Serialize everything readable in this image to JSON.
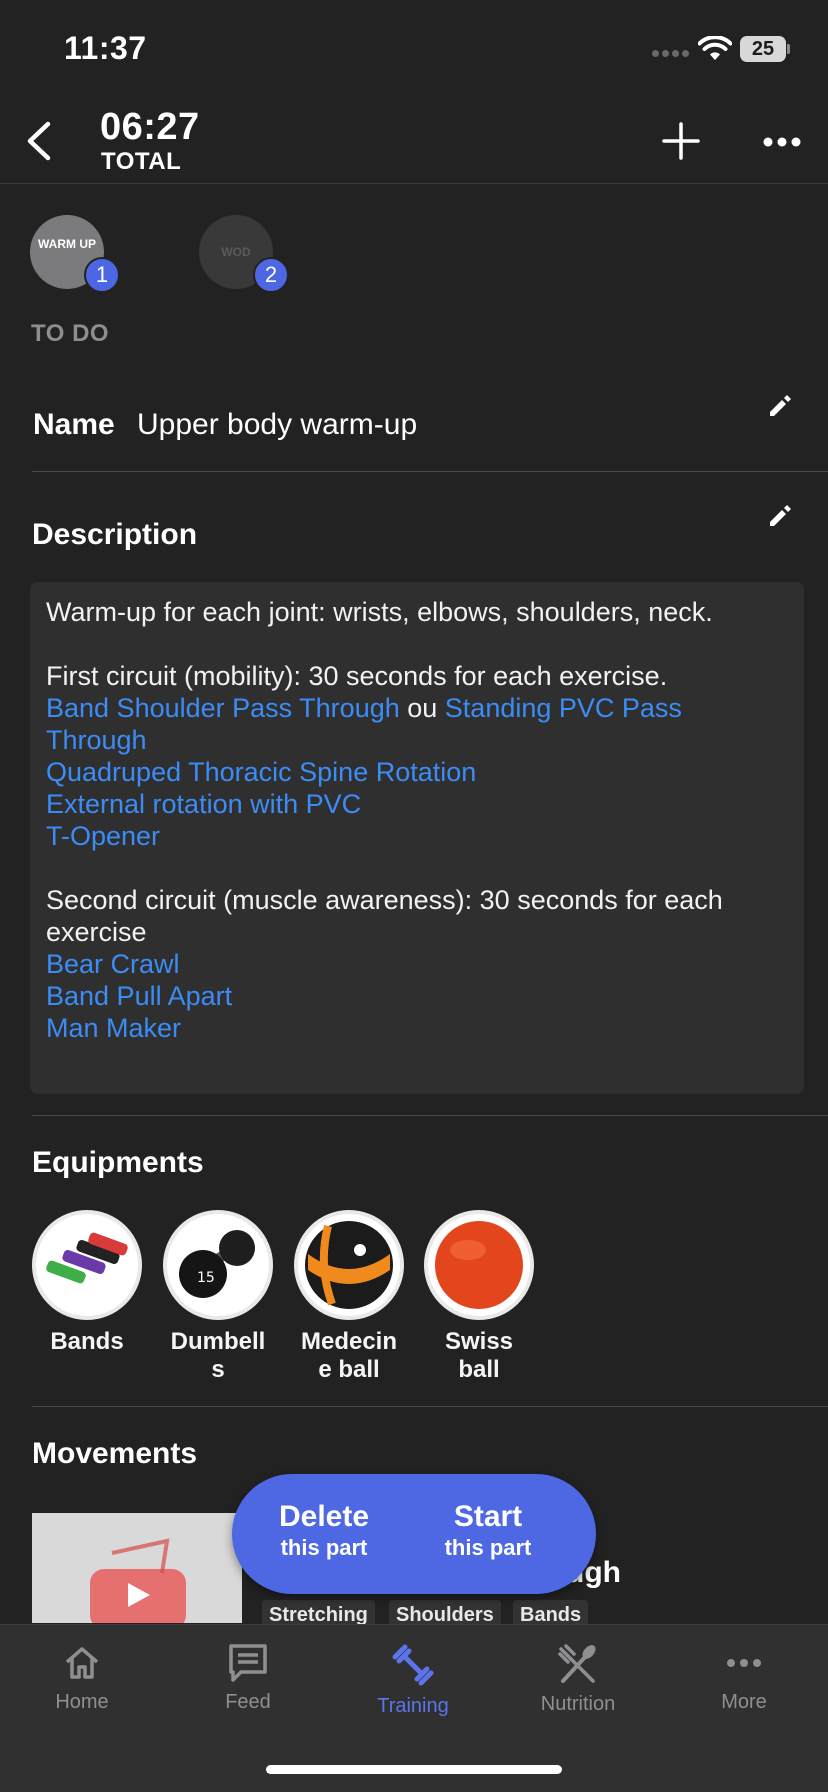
{
  "status_bar": {
    "time": "11:37",
    "battery": "25"
  },
  "header": {
    "timer": "06:27",
    "timer_label": "TOTAL"
  },
  "parts": [
    {
      "icon_text": "WARM UP",
      "badge": "1"
    },
    {
      "icon_text": "WOD",
      "badge": "2"
    }
  ],
  "part_status": "TO DO",
  "name": {
    "label": "Name",
    "value": "Upper body warm-up"
  },
  "description": {
    "title": "Description",
    "intro": "Warm-up for each joint: wrists, elbows, shoulders, neck.",
    "circuit1_title": "First circuit (mobility): 30 seconds for each exercise.",
    "circuit1_link1": "Band Shoulder Pass Through",
    "circuit1_or": " ou ",
    "circuit1_link2": "Standing PVC Pass Through",
    "circuit1_link3": "Quadruped Thoracic Spine Rotation",
    "circuit1_link4": "External rotation with PVC",
    "circuit1_link5": "T-Opener",
    "circuit2_title": "Second circuit (muscle awareness): 30 seconds for each exercise",
    "circuit2_link1": "Bear Crawl",
    "circuit2_link2": "Band Pull Apart",
    "circuit2_link3": "Man Maker"
  },
  "equipments": {
    "title": "Equipments",
    "items": [
      {
        "label_line1": "Bands",
        "label_line2": ""
      },
      {
        "label_line1": "Dumbell",
        "label_line2": "s"
      },
      {
        "label_line1": "Medecin",
        "label_line2": "e ball"
      },
      {
        "label_line1": "Swiss",
        "label_line2": "ball"
      }
    ]
  },
  "movements": {
    "title": "Movements",
    "first_title_visible": "rough",
    "tags": [
      "Stretching",
      "Shoulders",
      "Bands"
    ]
  },
  "actions": {
    "delete_line1": "Delete",
    "delete_line2": "this part",
    "start_line1": "Start",
    "start_line2": "this part"
  },
  "tabs": [
    {
      "label": "Home",
      "icon": "home-icon"
    },
    {
      "label": "Feed",
      "icon": "feed-icon"
    },
    {
      "label": "Training",
      "icon": "dumbbell-icon",
      "active": true
    },
    {
      "label": "Nutrition",
      "icon": "utensils-icon"
    },
    {
      "label": "More",
      "icon": "more-icon"
    }
  ],
  "colors": {
    "accent": "#4e67e3",
    "link": "#3c8cf5",
    "background": "#222223"
  }
}
